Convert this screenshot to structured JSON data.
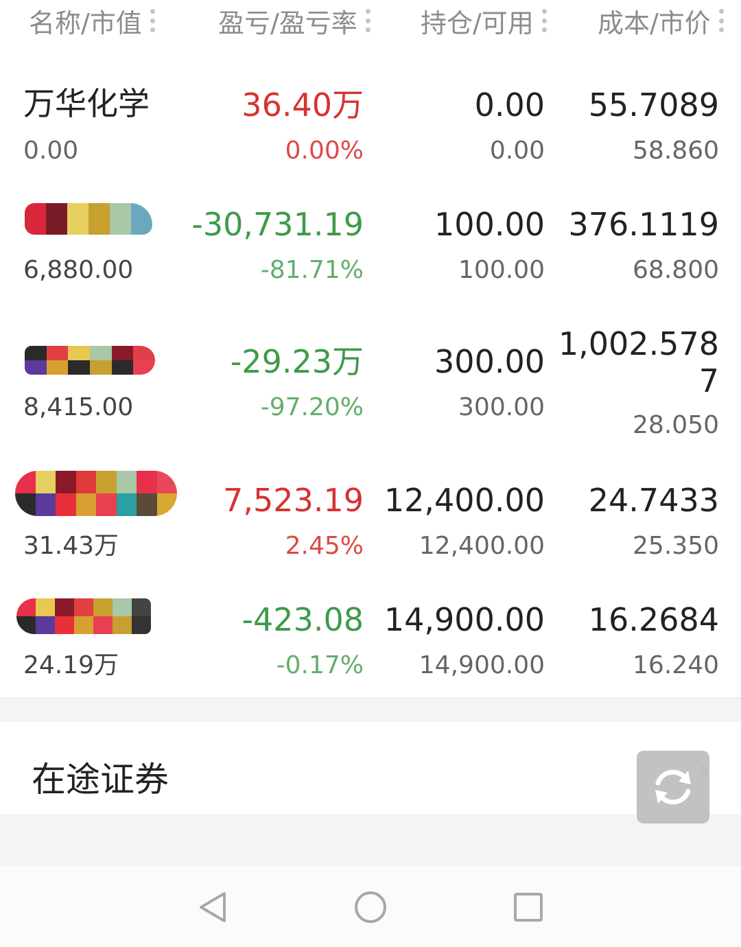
{
  "header": {
    "col1": "名称/市值",
    "col2": "盈亏/盈亏率",
    "col3": "持仓/可用",
    "col4": "成本/市价"
  },
  "holdings": [
    {
      "name": "万华化学",
      "market_value": "0.00",
      "pnl": "36.40万",
      "pnl_rate": "0.00%",
      "position": "0.00",
      "available": "0.00",
      "cost": "55.7089",
      "price": "58.860"
    },
    {
      "name": "",
      "market_value": "6,880.00",
      "pnl": "-30,731.19",
      "pnl_rate": "-81.71%",
      "position": "100.00",
      "available": "100.00",
      "cost": "376.1119",
      "price": "68.800"
    },
    {
      "name": "",
      "market_value": "8,415.00",
      "pnl": "-29.23万",
      "pnl_rate": "-97.20%",
      "position": "300.00",
      "available": "300.00",
      "cost_line1": "1,002.578",
      "cost_line2": "7",
      "price": "28.050"
    },
    {
      "name": "",
      "market_value": "31.43万",
      "pnl": "7,523.19",
      "pnl_rate": "2.45%",
      "position": "12,400.00",
      "available": "12,400.00",
      "cost": "24.7433",
      "price": "25.350"
    },
    {
      "name": "",
      "market_value": "24.19万",
      "pnl": "-423.08",
      "pnl_rate": "-0.17%",
      "position": "14,900.00",
      "available": "14,900.00",
      "cost": "16.2684",
      "price": "16.240"
    }
  ],
  "transit": {
    "label": "在途证券",
    "arrow_icon": "chevron-right-icon"
  },
  "floating": {
    "icon": "refresh-icon"
  },
  "nav": {
    "back_icon": "back-triangle-icon",
    "home_icon": "home-circle-icon",
    "recents_icon": "recents-square-icon"
  },
  "colors": {
    "gain": "#d6322f",
    "loss": "#3e9a4a"
  }
}
